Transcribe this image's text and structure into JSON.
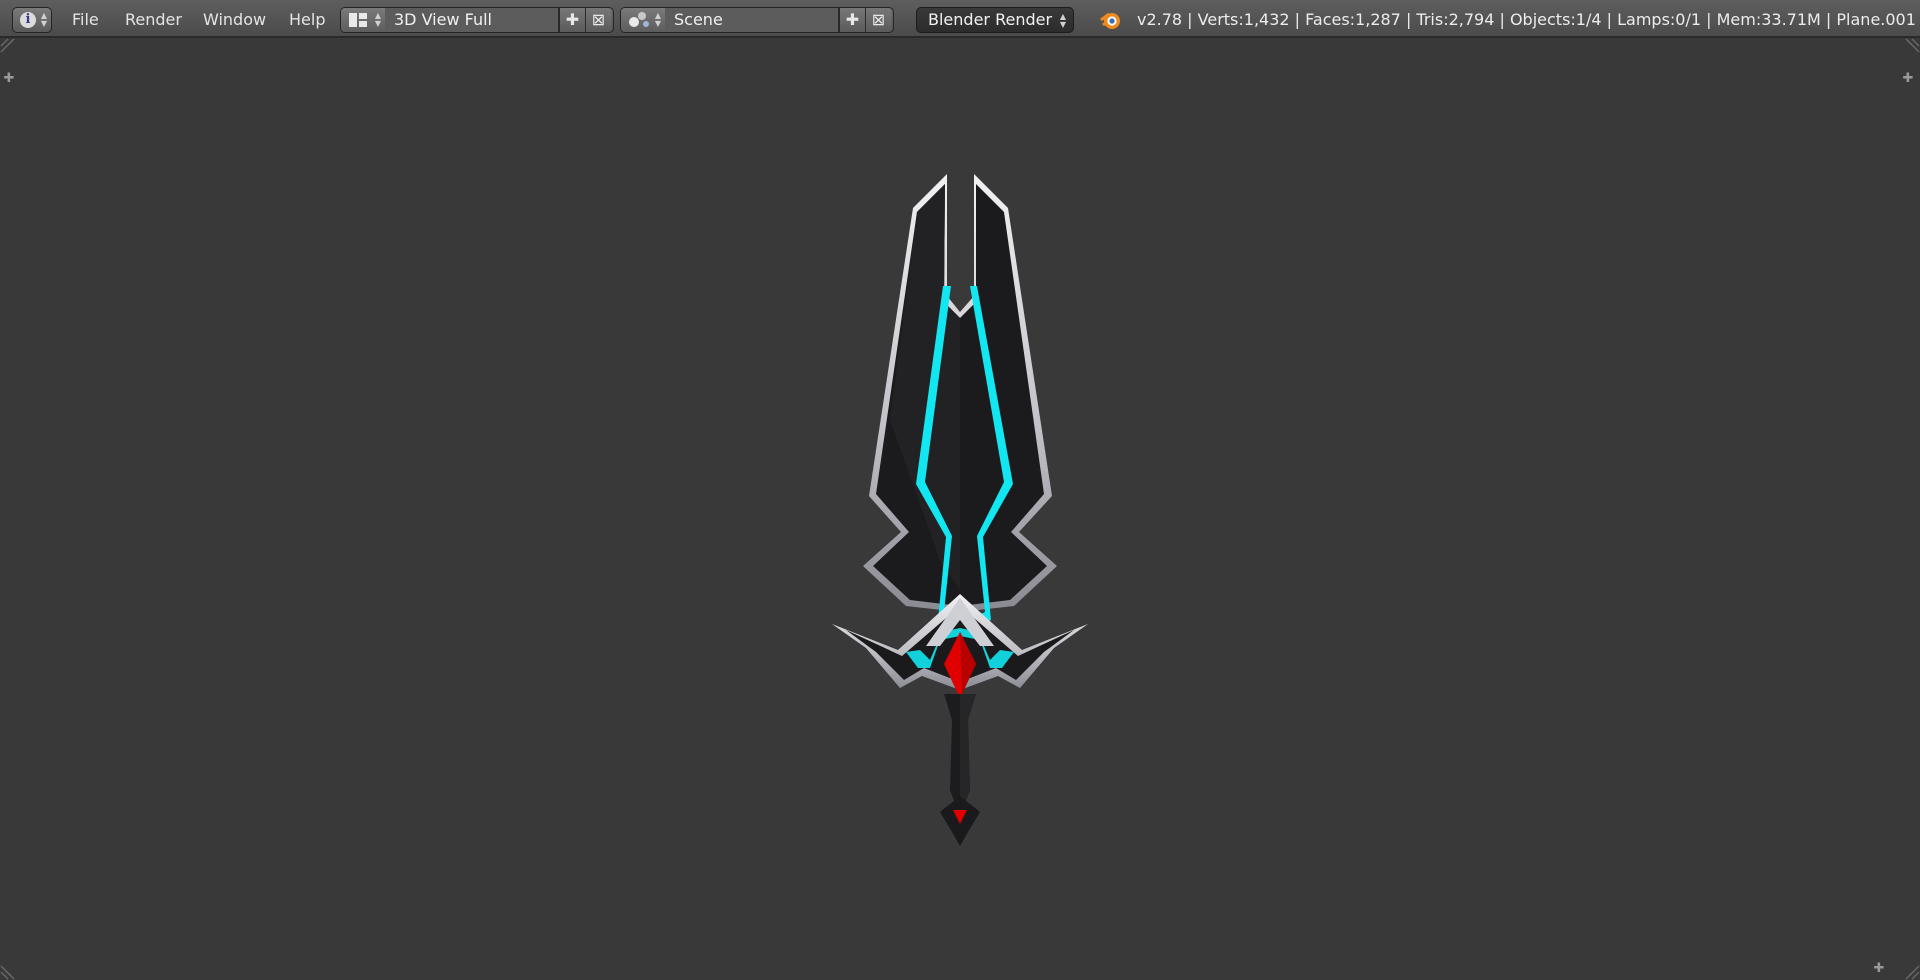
{
  "header": {
    "editor_type_icon": "info-icon",
    "menus": [
      "File",
      "Render",
      "Window",
      "Help"
    ],
    "screen_layout": {
      "icon": "screen-layout-icon",
      "value": "3D View Full",
      "add_icon": "plus-icon",
      "remove_icon": "close-icon"
    },
    "scene": {
      "icon": "scene-icon",
      "value": "Scene",
      "add_icon": "plus-icon",
      "remove_icon": "close-icon"
    },
    "render_engine": "Blender Render",
    "logo_icon": "blender-logo-icon",
    "stats": "v2.78 | Verts:1,432 | Faces:1,287 | Tris:2,794 | Objects:1/4 | Lamps:0/1 | Mem:33.71M | Plane.001"
  },
  "viewport": {
    "background": "#393939",
    "object": "sword",
    "colors": {
      "blade": "#1c1c1e",
      "edge": "#d8d8dc",
      "glow": "#12e6f0",
      "gem": "#e00000"
    }
  }
}
